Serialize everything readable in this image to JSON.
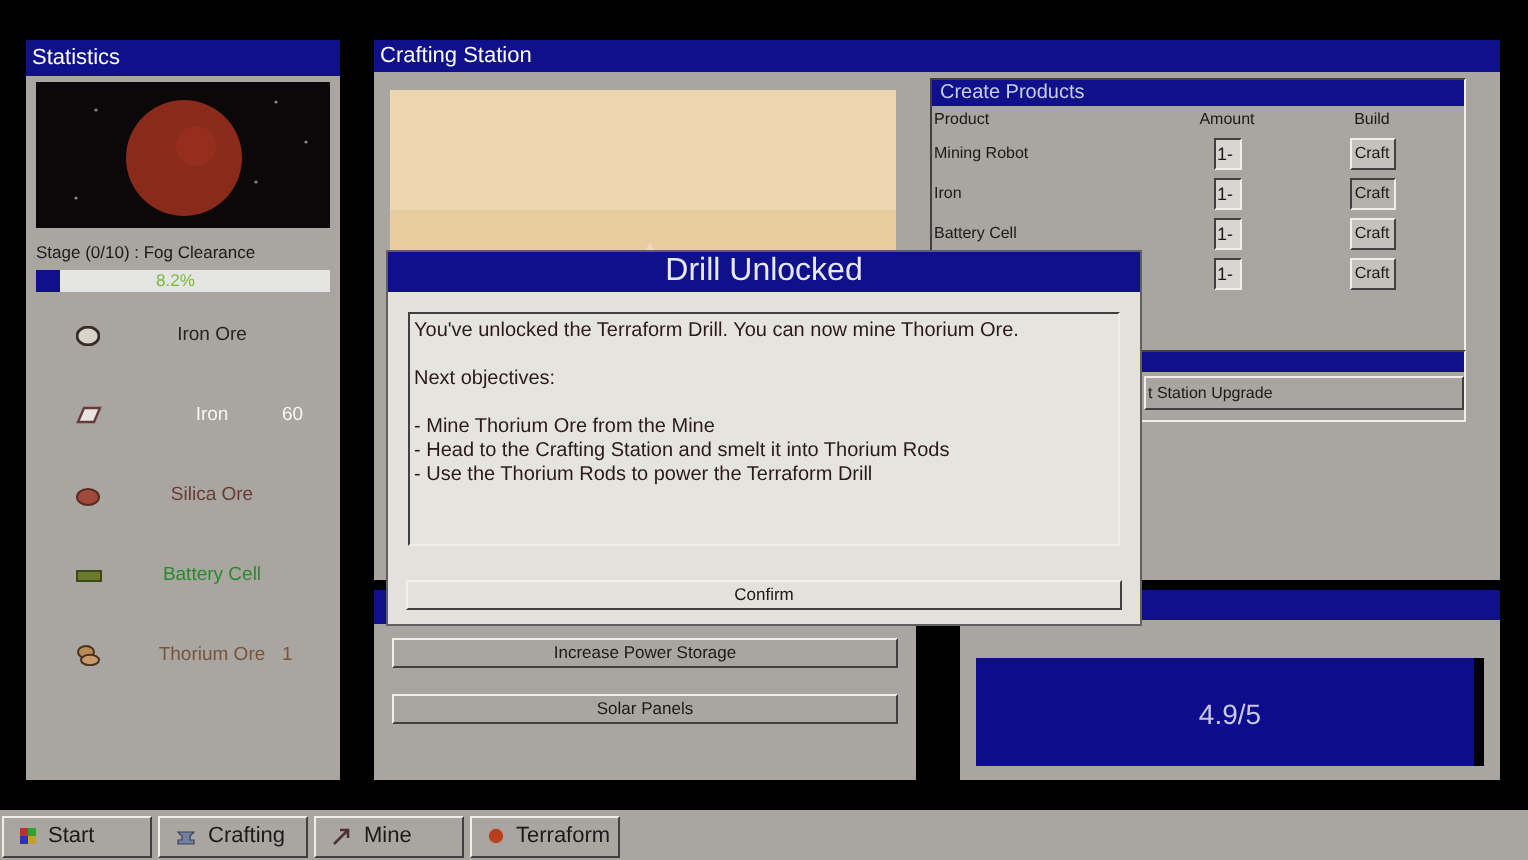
{
  "statistics": {
    "title": "Statistics",
    "stage": "Stage (0/10) : Fog Clearance",
    "progress": {
      "level": 0.082,
      "reading": "8.2%"
    },
    "resources": [
      {
        "name": "Iron Ore",
        "color": "#2a2420"
      },
      {
        "name": "Iron",
        "count": "60",
        "color": "#f8f6f2"
      },
      {
        "name": "Silica Ore",
        "color": "#6a3a34"
      },
      {
        "name": "Battery Cell",
        "color": "#2a8a2a"
      },
      {
        "name": "Thorium Ore",
        "count": "1",
        "color": "#7a5438"
      }
    ]
  },
  "crafting": {
    "title": "Crafting Station",
    "products": {
      "title": "Create Products",
      "columns": [
        "Product",
        "Amount",
        "Build"
      ],
      "rows": [
        {
          "product": "Mining Robot",
          "amount": "1-",
          "button": "Craft",
          "pressed": false
        },
        {
          "product": "Iron",
          "amount": "1-",
          "button": "Craft",
          "pressed": true
        },
        {
          "product": "Battery Cell",
          "amount": "1-",
          "button": "Craft",
          "pressed": false
        },
        {
          "amount": "1-",
          "button": "Craft",
          "pressed": false
        }
      ]
    },
    "upgrade_button": "t Station Upgrade"
  },
  "power": {
    "buttons": [
      "Increase Power Storage",
      "Solar Panels"
    ],
    "meter": {
      "level": 0.98,
      "reading": "4.9/5"
    }
  },
  "dialog": {
    "title": "Drill Unlocked",
    "message": "You've unlocked the Terraform Drill. You can now mine Thorium Ore.",
    "subheading": "Next objectives:",
    "objectives": [
      "- Mine Thorium Ore from the Mine",
      "- Head to the Crafting Station and smelt it into Thorium Rods",
      "- Use the Thorium Rods to power the Terraform Drill"
    ],
    "button": "Confirm"
  },
  "taskbar": [
    {
      "label": "Start"
    },
    {
      "label": "Crafting"
    },
    {
      "label": "Mine"
    },
    {
      "label": "Terraform"
    }
  ]
}
